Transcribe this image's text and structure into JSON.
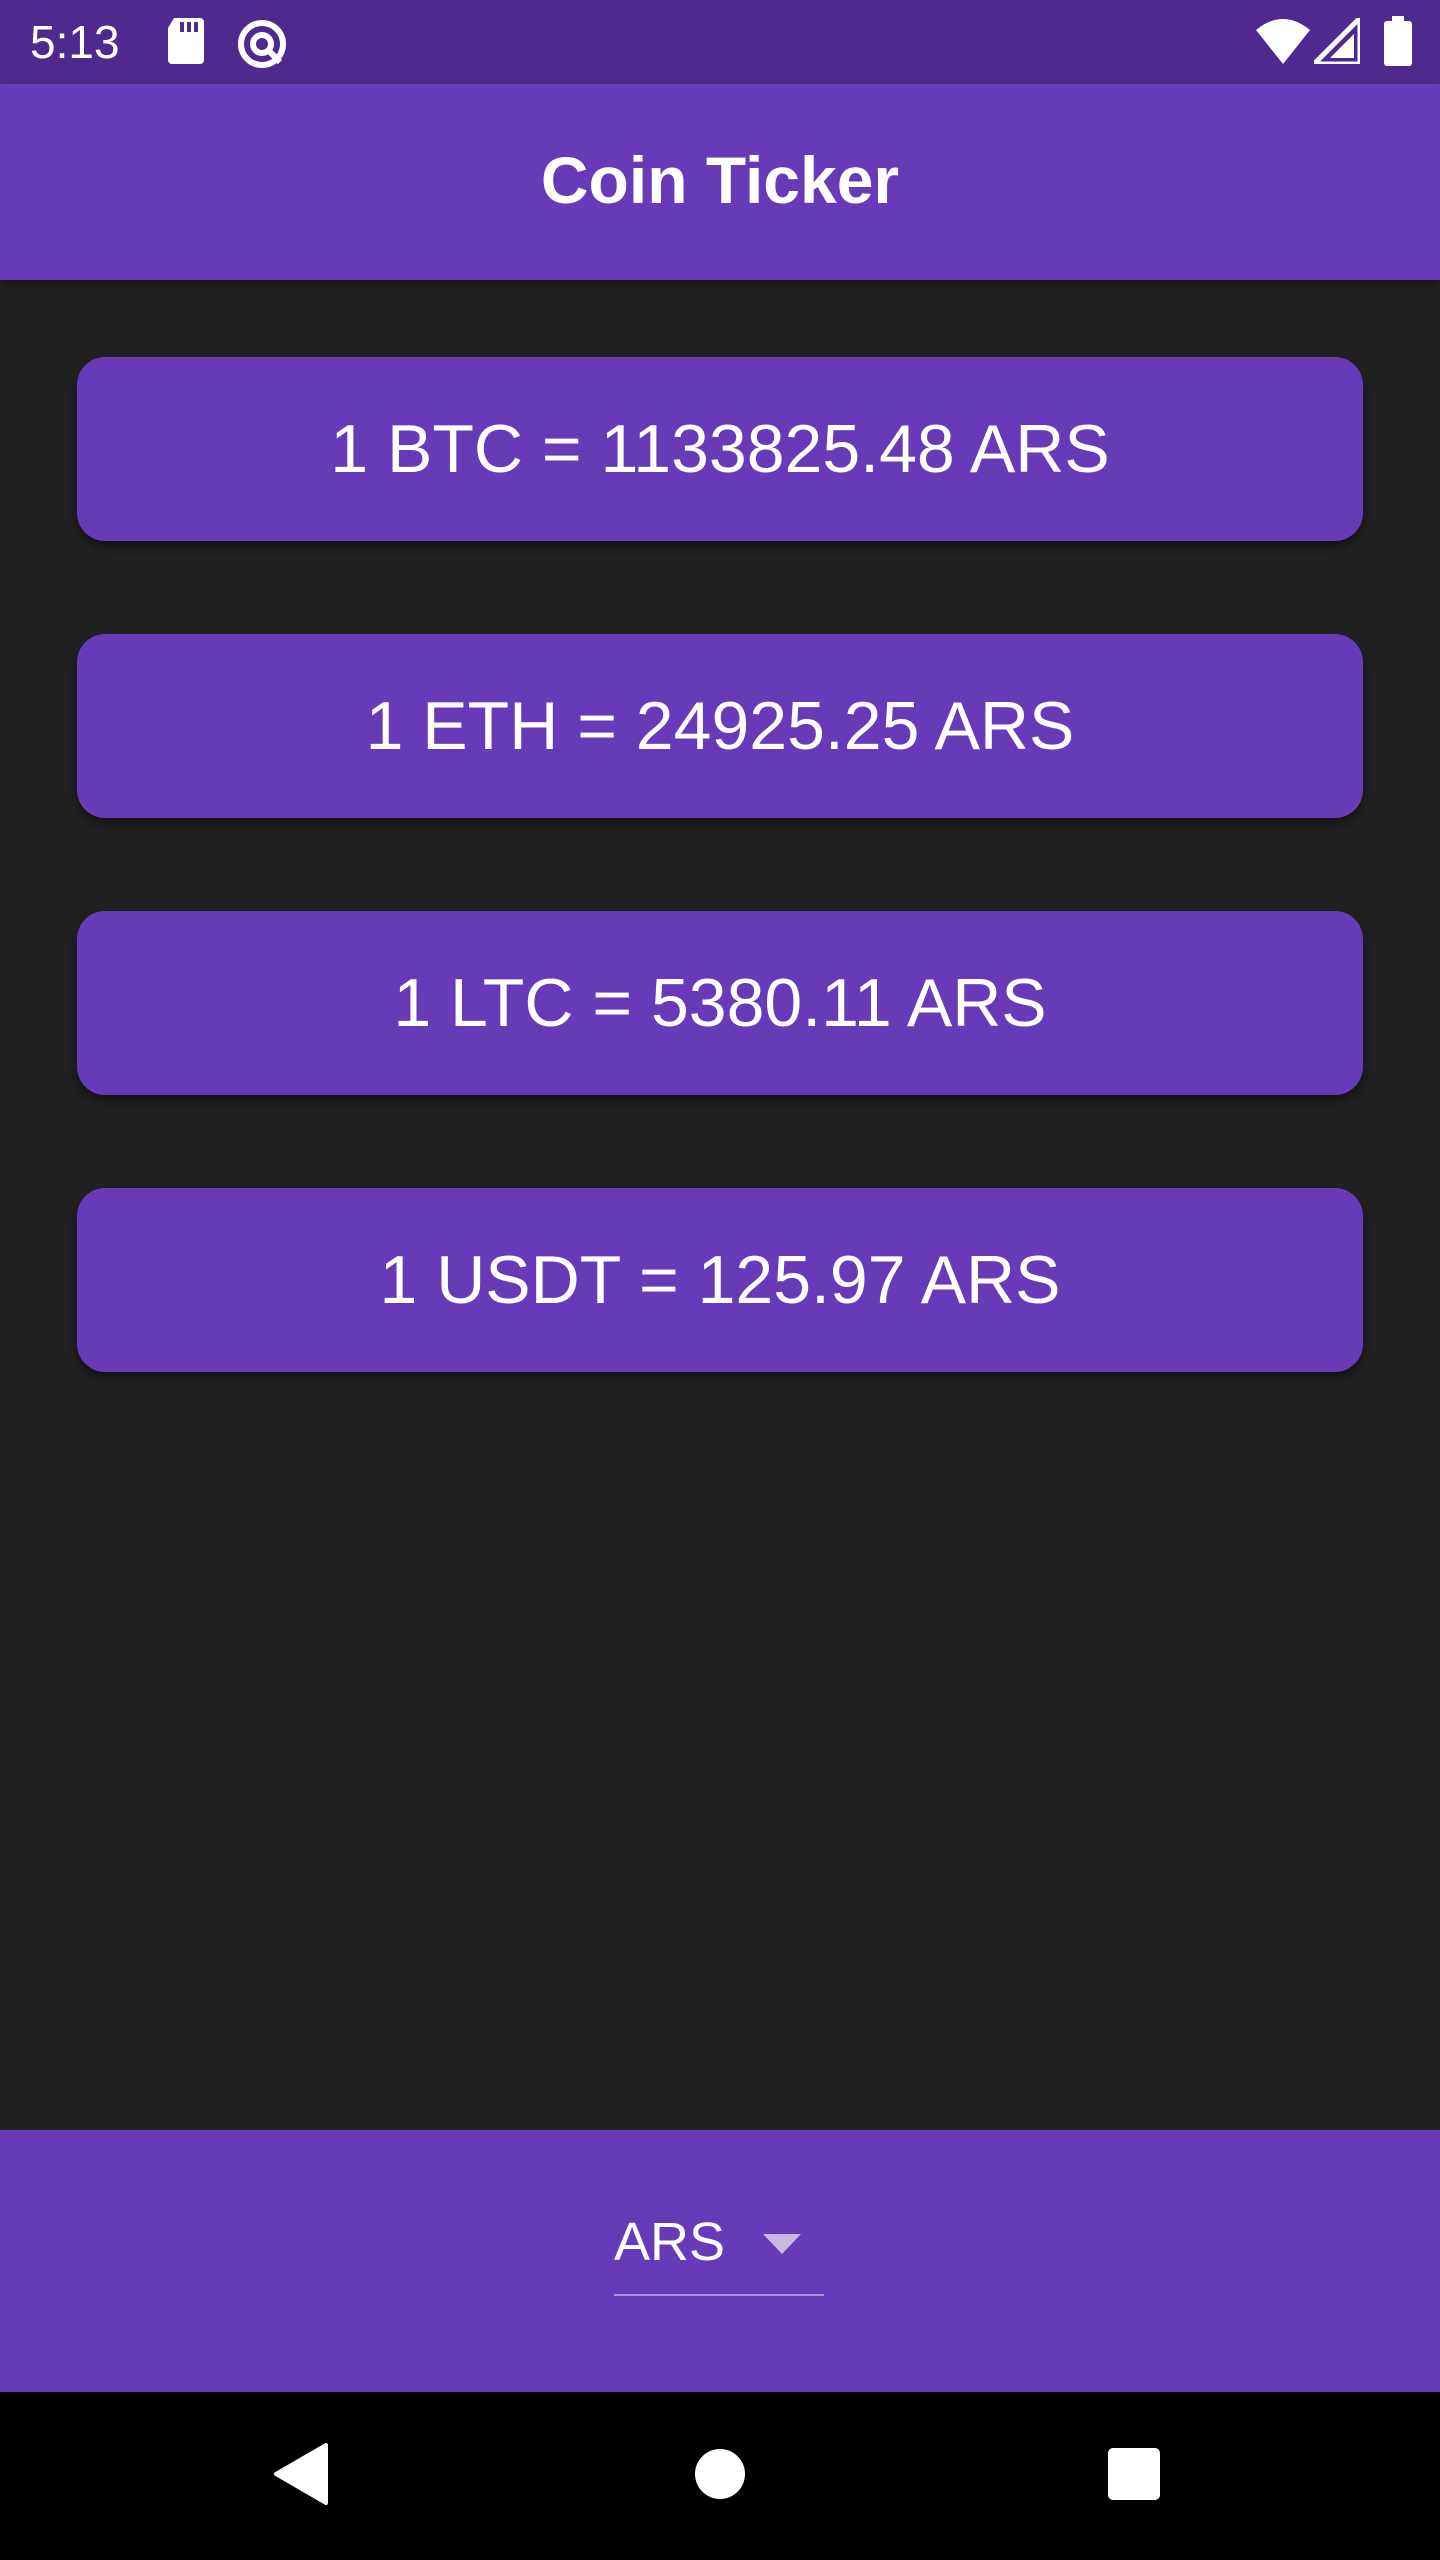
{
  "status_bar": {
    "time": "5:13",
    "icons": [
      "sd-card-icon",
      "data-saver-icon",
      "wifi-icon",
      "signal-icon",
      "battery-icon"
    ]
  },
  "app_bar": {
    "title": "Coin Ticker"
  },
  "rates": [
    {
      "text": "1 BTC = 1133825.48 ARS",
      "coin": "BTC",
      "value": "1133825.48",
      "currency": "ARS"
    },
    {
      "text": "1 ETH = 24925.25 ARS",
      "coin": "ETH",
      "value": "24925.25",
      "currency": "ARS"
    },
    {
      "text": "1 LTC = 5380.11 ARS",
      "coin": "LTC",
      "value": "5380.11",
      "currency": "ARS"
    },
    {
      "text": "1 USDT = 125.97 ARS",
      "coin": "USDT",
      "value": "125.97",
      "currency": "ARS"
    }
  ],
  "currency_picker": {
    "selected": "ARS"
  },
  "nav_bar": {
    "buttons": [
      "back-icon",
      "home-icon",
      "recents-icon"
    ]
  },
  "colors": {
    "status_bar": "#4e2a8e",
    "primary": "#673ab7",
    "background": "#212121",
    "nav_bar": "#000000",
    "text": "#ffffff"
  }
}
